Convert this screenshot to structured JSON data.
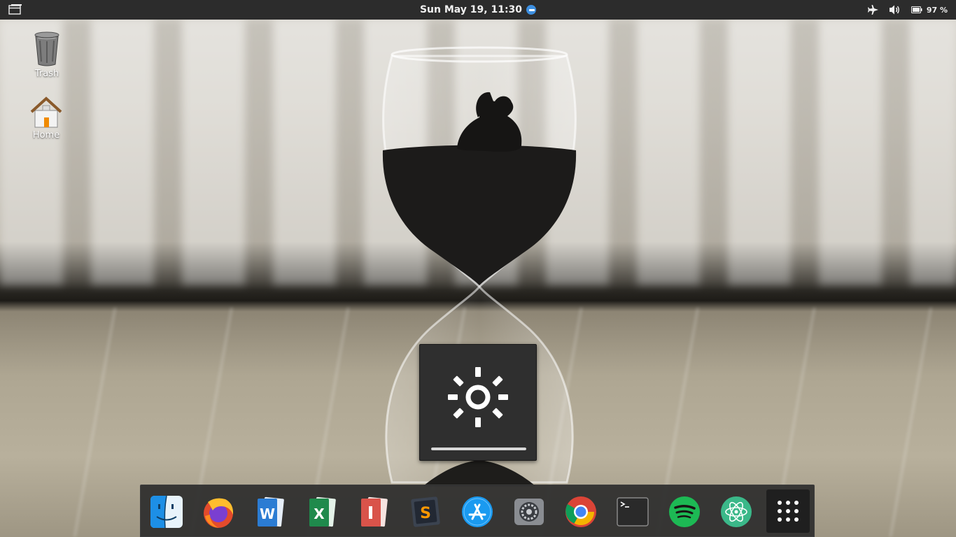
{
  "panel": {
    "clock": "Sun May 19, 11:30",
    "battery_percent": "97 %",
    "icons": [
      "window-switcher-icon",
      "notification-icon",
      "airplane-icon",
      "volume-icon",
      "battery-icon"
    ]
  },
  "desktop": {
    "icons": [
      {
        "label": "Trash",
        "icon": "trash-icon"
      },
      {
        "label": "Home",
        "icon": "home-folder-icon"
      }
    ]
  },
  "osd": {
    "type": "brightness",
    "icon": "brightness-icon",
    "level": 1.0
  },
  "dock": {
    "items": [
      {
        "name": "finder",
        "icon": "finder-icon"
      },
      {
        "name": "firefox",
        "icon": "firefox-icon"
      },
      {
        "name": "word",
        "icon": "word-icon"
      },
      {
        "name": "excel",
        "icon": "excel-icon"
      },
      {
        "name": "impress",
        "icon": "presentation-icon"
      },
      {
        "name": "sublime-text",
        "icon": "sublime-text-icon"
      },
      {
        "name": "app-store",
        "icon": "app-store-icon"
      },
      {
        "name": "system-settings",
        "icon": "settings-icon"
      },
      {
        "name": "chrome",
        "icon": "chrome-icon"
      },
      {
        "name": "terminal",
        "icon": "terminal-icon"
      },
      {
        "name": "spotify",
        "icon": "spotify-icon"
      },
      {
        "name": "atom",
        "icon": "atom-icon"
      },
      {
        "name": "show-applications",
        "icon": "app-grid-icon"
      }
    ]
  },
  "colors": {
    "panel_bg": "#2c2c2c",
    "dock_bg": "#2c2c2c",
    "accent": "#3d8fe0"
  }
}
